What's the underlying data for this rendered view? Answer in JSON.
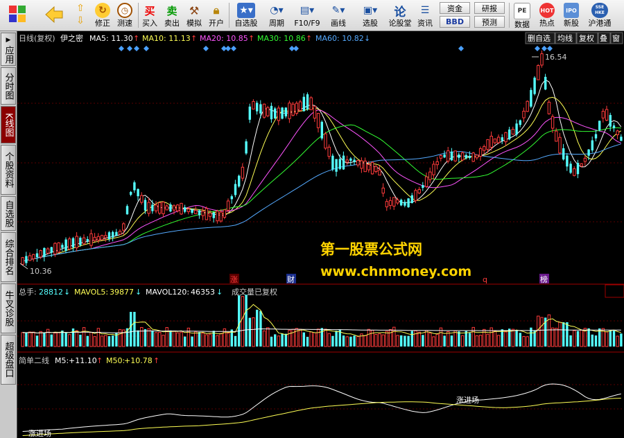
{
  "colors": {
    "up": "#ff3b3b",
    "down": "#55ffff",
    "ma5": "#ffffff",
    "ma10": "#ffff55",
    "ma20": "#ff55ff",
    "ma30": "#33ff33",
    "ma60": "#55aaff",
    "vol_line": "#ffff55"
  },
  "toolbar": {
    "buttons": [
      {
        "label": "修正",
        "icon": "refresh-icon"
      },
      {
        "label": "测速",
        "icon": "clock-icon"
      },
      {
        "label": "买入",
        "icon": "buy-icon",
        "glyph": "买"
      },
      {
        "label": "卖出",
        "icon": "sell-icon",
        "glyph": "卖"
      },
      {
        "label": "模拟",
        "icon": "hammer-icon"
      },
      {
        "label": "开户",
        "icon": "lock-icon"
      },
      {
        "label": "自选股",
        "icon": "star-icon"
      },
      {
        "label": "周期",
        "icon": "cycle-icon"
      },
      {
        "label": "F10/F9",
        "icon": "document-icon"
      },
      {
        "label": "画线",
        "icon": "pencil-icon"
      },
      {
        "label": "选股",
        "icon": "screen-icon"
      },
      {
        "label": "论股堂",
        "icon": "forum-icon",
        "glyph": "论"
      },
      {
        "label": "资讯",
        "icon": "news-icon"
      },
      {
        "label": "数据",
        "icon": "pe-icon",
        "glyph": "PE"
      },
      {
        "label": "热点",
        "icon": "hot-icon",
        "glyph": "HOT"
      },
      {
        "label": "新股",
        "icon": "ipo-icon",
        "glyph": "IPO"
      },
      {
        "label": "沪港通",
        "icon": "sse-hkex-icon",
        "glyph": "SSE HKE"
      }
    ],
    "small": [
      "资金",
      "研报",
      "BBD",
      "预测"
    ]
  },
  "sidebar": {
    "tabs": [
      "应用",
      "分时图",
      "K线图",
      "个股资料",
      "自选股",
      "综合排名",
      "牛叉诊股",
      "超级盘口"
    ],
    "active_index": 2
  },
  "price_panel": {
    "period": "日线(复权)",
    "stock": "伊之密",
    "ma": [
      {
        "label": "MA5: 11.30",
        "arrow": "↑"
      },
      {
        "label": "MA10: 11.13",
        "arrow": "↑"
      },
      {
        "label": "MA20: 10.85",
        "arrow": "↑"
      },
      {
        "label": "MA30: 10.86",
        "arrow": "↑"
      },
      {
        "label": "MA60: 10.82",
        "arrow": "↓"
      }
    ],
    "buttons": [
      "删自选",
      "均线",
      "复权",
      "叠",
      "窗"
    ],
    "high_label": "16.54",
    "low_label": "10.36",
    "events": [
      {
        "label": "涨",
        "color": "#ff3b3b",
        "bg": "#5a0000"
      },
      {
        "label": "财",
        "color": "#ffffff",
        "bg": "#1a2e8c"
      },
      {
        "label": "q",
        "color": "#ff3b3b",
        "bg": ""
      },
      {
        "label": "榜",
        "color": "#ffffff",
        "bg": "#6a1a8c"
      }
    ]
  },
  "volume_panel": {
    "total_label": "总手:",
    "total_value": "28812",
    "total_arrow": "↓",
    "mavol5_label": "MAVOL5:",
    "mavol5_value": "39877",
    "mavol5_arrow": "↓",
    "mavol120_label": "MAVOL120:",
    "mavol120_value": "46353",
    "mavol120_arrow": "↓",
    "note": "成交量已复权"
  },
  "indicator_panel": {
    "name": "简单二线",
    "m5_label": "M5:",
    "m5_value": "+11.10",
    "m5_arrow": "↑",
    "m50_label": "M50:",
    "m50_value": "+10.78",
    "m50_arrow": "↑",
    "signals": [
      "涨进场",
      "涨进场"
    ]
  },
  "watermark": {
    "title": "第一股票公式网",
    "url": "www.chnmoney.com"
  }
}
